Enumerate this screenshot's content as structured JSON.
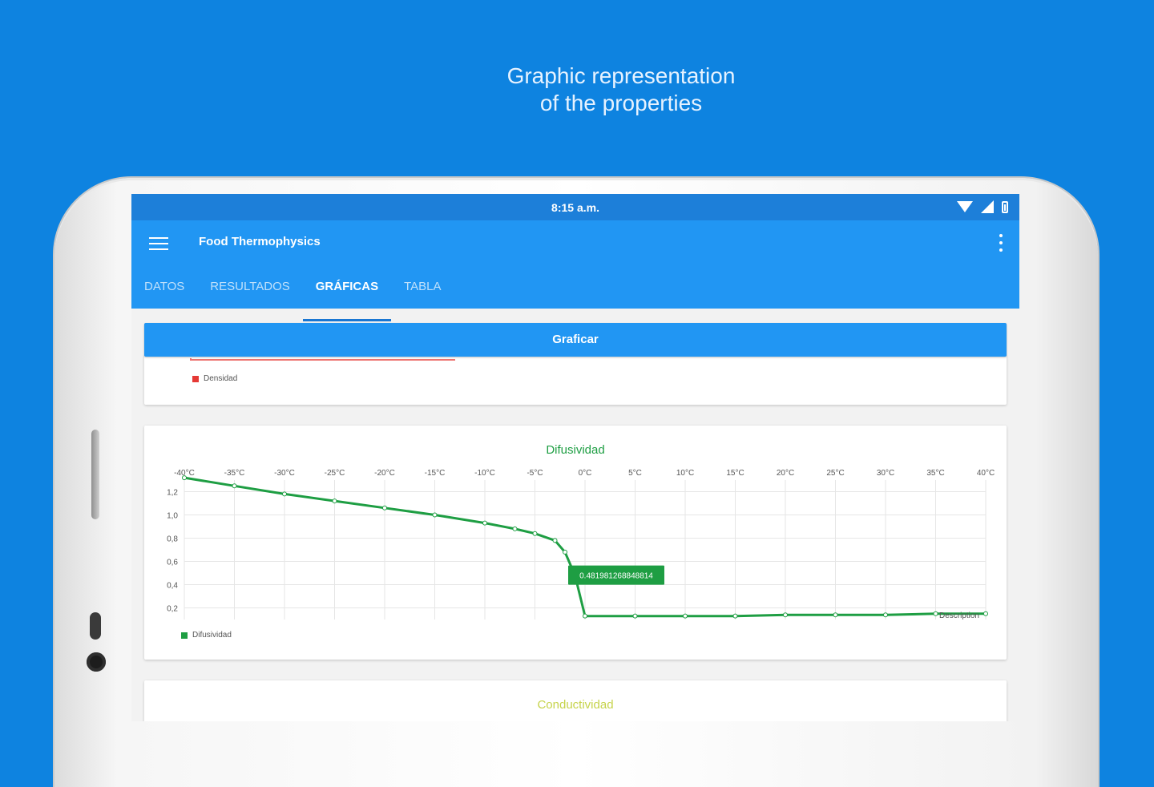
{
  "promo": {
    "line1": "Graphic representation",
    "line2": "of the properties"
  },
  "status": {
    "time": "8:15 a.m."
  },
  "appbar": {
    "title": "Food Thermophysics"
  },
  "tabs": [
    {
      "label": "DATOS"
    },
    {
      "label": "RESULTADOS"
    },
    {
      "label": "GRÁFICAS"
    },
    {
      "label": "TABLA"
    }
  ],
  "actions": {
    "plot_label": "Graficar"
  },
  "cards": {
    "density": {
      "legend": "Densidad",
      "color": "#e53935"
    },
    "diffusivity": {
      "title": "Difusividad",
      "legend": "Difusividad",
      "color": "#1e9e43"
    },
    "conductivity": {
      "title": "Conductividad",
      "color": "#c6d34a"
    }
  },
  "chart_data": {
    "type": "line",
    "title": "Difusividad",
    "x_ticks": [
      "-40°C",
      "-35°C",
      "-30°C",
      "-25°C",
      "-20°C",
      "-15°C",
      "-10°C",
      "-5°C",
      "0°C",
      "5°C",
      "10°C",
      "15°C",
      "20°C",
      "25°C",
      "30°C",
      "35°C",
      "40°C"
    ],
    "y_ticks": [
      "1,2",
      "1,0",
      "0,8",
      "0,6",
      "0,4",
      "0,2"
    ],
    "xlim": [
      -40,
      40
    ],
    "ylim": [
      0.1,
      1.3
    ],
    "series": [
      {
        "name": "Difusividad",
        "x": [
          -40,
          -35,
          -30,
          -25,
          -20,
          -15,
          -10,
          -7,
          -5,
          -3,
          -2,
          -1,
          0,
          5,
          10,
          15,
          20,
          25,
          30,
          35,
          40
        ],
        "y": [
          1.32,
          1.25,
          1.18,
          1.12,
          1.06,
          1.0,
          0.93,
          0.88,
          0.84,
          0.78,
          0.68,
          0.48,
          0.13,
          0.13,
          0.13,
          0.13,
          0.14,
          0.14,
          0.14,
          0.15,
          0.15
        ]
      }
    ],
    "marker_label": "0.481981268848814",
    "description_label": "Description",
    "grid": true,
    "legend": "bottom-left"
  }
}
